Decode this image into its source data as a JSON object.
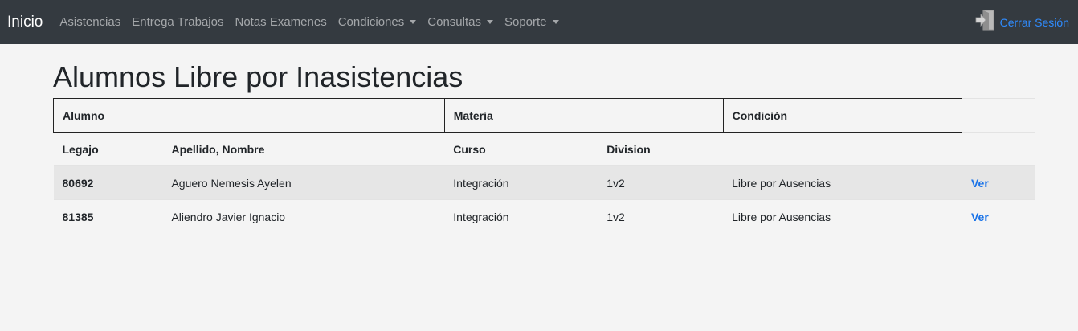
{
  "navbar": {
    "brand": "Inicio",
    "items": [
      {
        "label": "Asistencias"
      },
      {
        "label": "Entrega Trabajos"
      },
      {
        "label": "Notas Examenes"
      },
      {
        "label": "Condiciones"
      },
      {
        "label": "Consultas"
      },
      {
        "label": "Soporte"
      }
    ],
    "logout_label": "Cerrar Sesión",
    "logout_icon": "exit-door-icon"
  },
  "page": {
    "title": "Alumnos Libre por Inasistencias"
  },
  "table": {
    "group_headers": [
      "Alumno",
      "Materia",
      "Condición"
    ],
    "sub_headers": [
      "Legajo",
      "Apellido, Nombre",
      "Curso",
      "Division"
    ],
    "rows": [
      {
        "legajo": "80692",
        "nombre": "Aguero Nemesis Ayelen",
        "curso": "Integración",
        "division": "1v2",
        "condicion": "Libre por Ausencias",
        "action": "Ver"
      },
      {
        "legajo": "81385",
        "nombre": "Aliendro Javier Ignacio",
        "curso": "Integración",
        "division": "1v2",
        "condicion": "Libre por Ausencias",
        "action": "Ver"
      }
    ]
  },
  "colors": {
    "navbar_bg": "#343a40",
    "link": "#1a73e8",
    "page_bg": "#f4f4f4"
  }
}
